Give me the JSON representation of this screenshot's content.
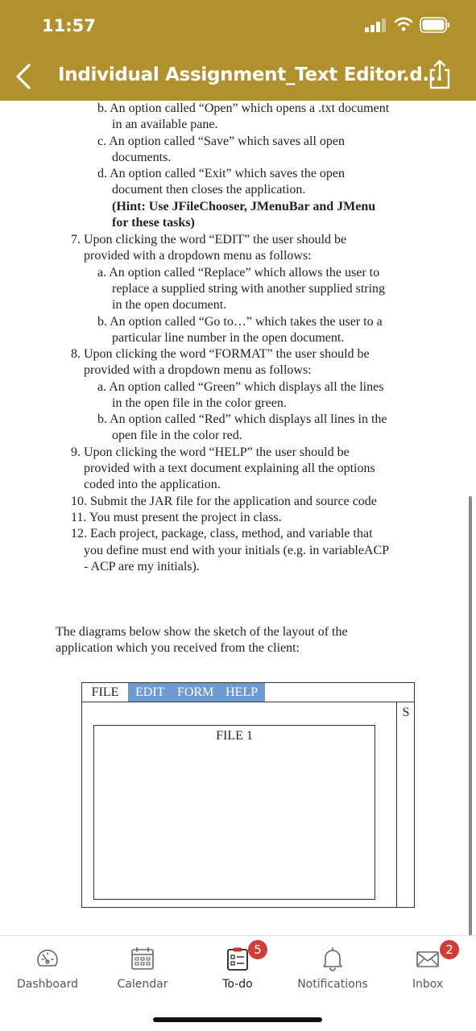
{
  "status_bar": {
    "time": "11:57"
  },
  "header": {
    "title": "Individual Assignment_Text Editor.d..."
  },
  "document": {
    "lines": [
      {
        "text": "b. An option called “Open” which opens a .txt document"
      },
      {
        "text": "in an available pane."
      },
      {
        "text": "c. An option called “Save” which saves all open"
      },
      {
        "text": "documents."
      },
      {
        "text": "d. An option called “Exit” which saves the open"
      },
      {
        "text": "document then closes the application."
      },
      {
        "text": "(Hint: Use JFileChooser, JMenuBar and JMenu"
      },
      {
        "text": "for these tasks)"
      },
      {
        "text": "7. Upon clicking the word “EDIT” the user should be"
      },
      {
        "text": "provided with a dropdown menu as follows:"
      },
      {
        "text": "a. An option called “Replace” which allows the user to"
      },
      {
        "text": "replace a supplied string with another supplied string"
      },
      {
        "text": "in the open document."
      },
      {
        "text": "b. An option called “Go to…” which takes the user to a"
      },
      {
        "text": "particular line number in the open document."
      },
      {
        "text": "8. Upon clicking the word “FORMAT” the user should be"
      },
      {
        "text": "provided with a dropdown menu as follows:"
      },
      {
        "text": "a. An option called “Green” which displays all the lines"
      },
      {
        "text": "in the open file in the color green."
      },
      {
        "text": "b. An option called “Red” which displays all lines in the"
      },
      {
        "text": "open file in the color red."
      },
      {
        "text": "9. Upon clicking the word “HELP” the user should be"
      },
      {
        "text": "provided with a text document explaining all the options"
      },
      {
        "text": "coded into the application."
      },
      {
        "text": "10. Submit the JAR file for the application and source code"
      },
      {
        "text": "11. You must present the project in class."
      },
      {
        "text": "12. Each project, package, class, method, and variable that"
      },
      {
        "text": "you define must end with your initials (e.g.  in variableACP"
      },
      {
        "text": "- ACP are my initials)."
      },
      {
        "text": "The diagrams below show the sketch of the layout of the"
      },
      {
        "text": "application which you received from the client:"
      }
    ],
    "sketch": {
      "menu_file": "FILE",
      "menu_edit": "EDIT",
      "menu_form": "FORM",
      "menu_help": "HELP",
      "scroll_label": "S",
      "pane_label": "FILE 1"
    }
  },
  "tabbar": {
    "items": [
      {
        "label": "Dashboard",
        "icon": "gauge-icon"
      },
      {
        "label": "Calendar",
        "icon": "calendar-icon"
      },
      {
        "label": "To-do",
        "icon": "todo-list-icon",
        "badge": "5"
      },
      {
        "label": "Notifications",
        "icon": "bell-icon"
      },
      {
        "label": "Inbox",
        "icon": "envelope-icon",
        "badge": "2"
      }
    ]
  },
  "colors": {
    "header": "#b0912d",
    "badge": "#d13c38",
    "menu_highlight": "#6d9ad3"
  }
}
